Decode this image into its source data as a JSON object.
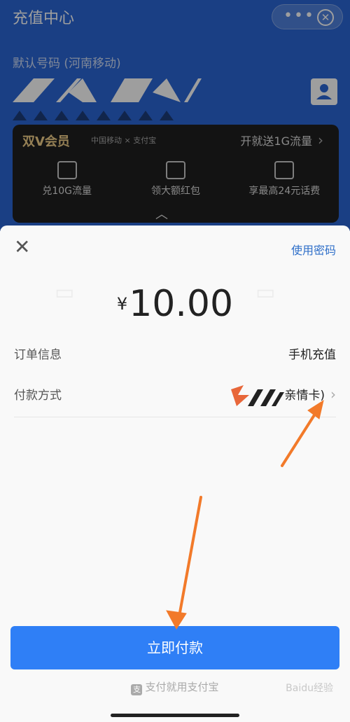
{
  "background": {
    "title": "充值中心",
    "default_number_label": "默认号码 (河南移动)",
    "vip": {
      "title": "双V会员",
      "brands": "中国移动 × 支付宝",
      "promo": "开就送1G流量",
      "items": [
        "兑10G流量",
        "领大额红包",
        "享最高24元话费"
      ]
    }
  },
  "sheet": {
    "use_password": "使用密码",
    "currency": "¥",
    "amount": "10.00",
    "order_label": "订单信息",
    "order_value": "手机充值",
    "pay_method_label": "付款方式",
    "pay_method_value": "亲情卡)",
    "pay_button": "立即付款",
    "footer": "支付就用支付宝"
  },
  "watermark": "Baidu经验",
  "colors": {
    "accent": "#2f7ff6",
    "bg_blue": "#2a66d6",
    "arrow": "#f27a2a"
  }
}
